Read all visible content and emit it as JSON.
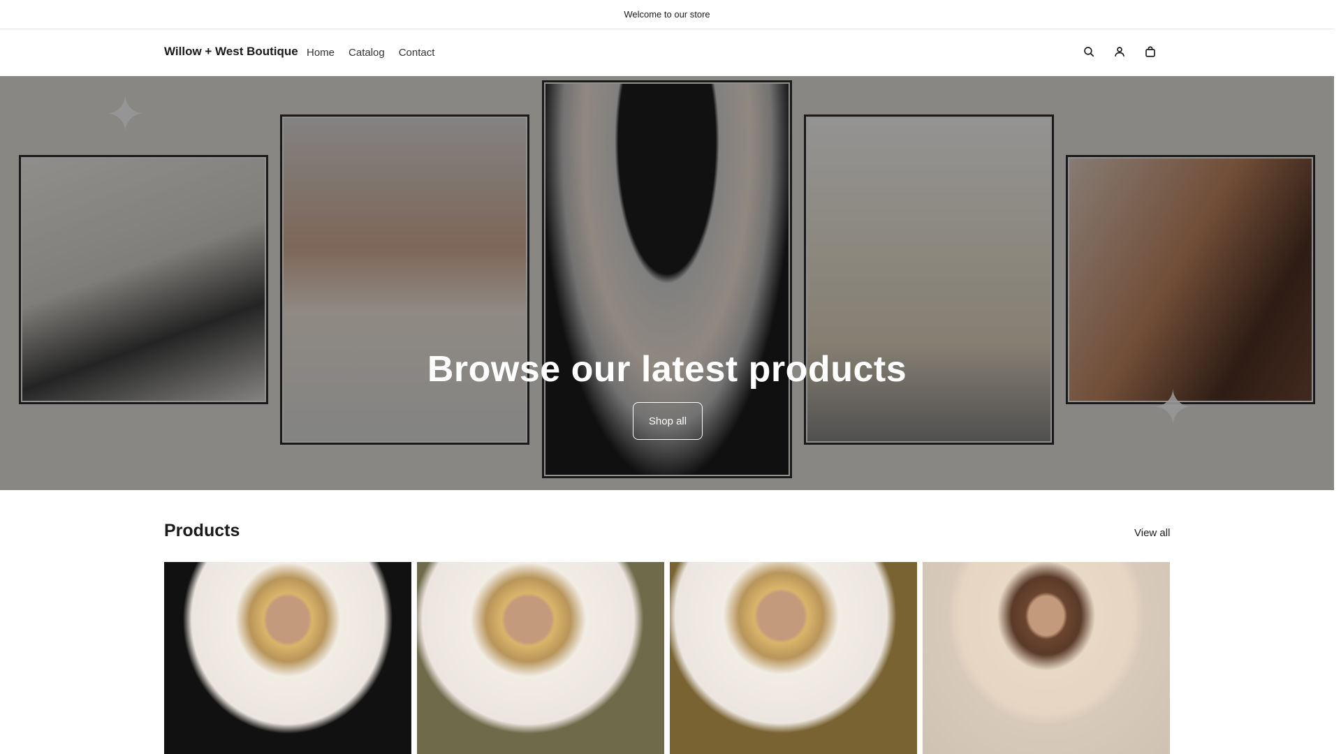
{
  "announcement": {
    "text": "Welcome to our store"
  },
  "header": {
    "brand": "Willow + West Boutique",
    "nav": [
      {
        "label": "Home"
      },
      {
        "label": "Catalog"
      },
      {
        "label": "Contact"
      }
    ],
    "icons": [
      "search-icon",
      "account-icon",
      "cart-icon"
    ]
  },
  "hero": {
    "title": "Browse our latest products",
    "button_label": "Shop all"
  },
  "products": {
    "title": "Products",
    "view_all_label": "View all",
    "items": [
      {
        "image": "woman in black turtleneck"
      },
      {
        "image": "woman in olive v-neck tee"
      },
      {
        "image": "woman in brown tank top"
      },
      {
        "image": "woman in beige cable-knit sweater"
      }
    ]
  }
}
